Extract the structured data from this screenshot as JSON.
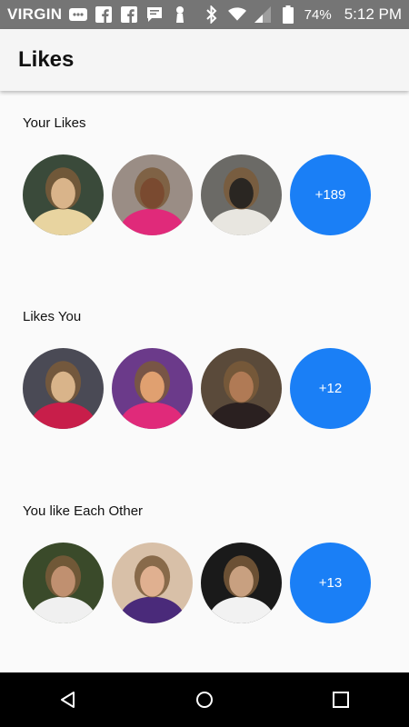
{
  "status_bar": {
    "carrier": "VIRGIN",
    "battery": "74%",
    "time": "5:12 PM",
    "icons": [
      "message-icon",
      "facebook-icon",
      "facebook-icon",
      "chat-icon",
      "notification-icon",
      "bluetooth-icon",
      "wifi-icon",
      "signal-icon",
      "battery-icon"
    ]
  },
  "header": {
    "title": "Likes"
  },
  "sections": [
    {
      "title": "Your Likes",
      "avatars": [
        {
          "name": "profile-photo",
          "colors": [
            "#3a4a3a",
            "#d9b48a",
            "#e8d4a0"
          ]
        },
        {
          "name": "profile-photo",
          "colors": [
            "#9a8d85",
            "#7a4a30",
            "#e02a7a"
          ]
        },
        {
          "name": "profile-photo",
          "colors": [
            "#6b6a66",
            "#2a2622",
            "#e8e6e0"
          ]
        }
      ],
      "more_count": "+189"
    },
    {
      "title": "Likes You",
      "avatars": [
        {
          "name": "profile-photo",
          "colors": [
            "#4a4a55",
            "#d9b48a",
            "#c81e4a"
          ]
        },
        {
          "name": "profile-photo",
          "colors": [
            "#6b3a8a",
            "#e0a070",
            "#e02a7a"
          ]
        },
        {
          "name": "profile-photo",
          "colors": [
            "#5a4a3a",
            "#b07a55",
            "#2a2020"
          ]
        }
      ],
      "more_count": "+12"
    },
    {
      "title": "You like Each Other",
      "avatars": [
        {
          "name": "profile-photo",
          "colors": [
            "#3a4a2a",
            "#c09070",
            "#f0f0f0"
          ]
        },
        {
          "name": "profile-photo",
          "colors": [
            "#d8c0a8",
            "#e0b090",
            "#4a2a7a"
          ]
        },
        {
          "name": "profile-photo",
          "colors": [
            "#1a1a1a",
            "#c8a080",
            "#f2f2f2"
          ]
        }
      ],
      "more_count": "+13"
    }
  ],
  "nav": {
    "buttons": [
      "back-icon",
      "home-icon",
      "recents-icon"
    ]
  },
  "colors": {
    "accent": "#1a7ff6",
    "status_bar": "#757575",
    "app_bar": "#f5f5f5",
    "background": "#fafafa"
  }
}
